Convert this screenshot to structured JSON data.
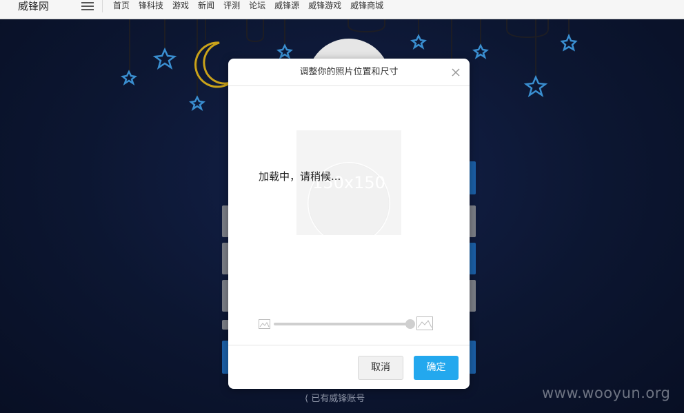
{
  "site": {
    "logo": "威锋网",
    "nav": [
      "首页",
      "锋科技",
      "游戏",
      "新闻",
      "评测",
      "论坛",
      "威锋源",
      "威锋游戏",
      "威锋商城"
    ]
  },
  "dialog": {
    "title": "调整你的照片位置和尺寸",
    "loading_text": "加载中，请稍候...",
    "placeholder_text": "150x150",
    "zoom_level": 1.0,
    "cancel_label": "取消",
    "confirm_label": "确定"
  },
  "page": {
    "login_link": "已有威锋账号",
    "watermark": "www.wooyun.org"
  },
  "colors": {
    "primary": "#23a8ee",
    "background": "#0c1530",
    "star": "#3a8fd1",
    "moon": "#c9a21a"
  },
  "icons": [
    "menu-icon",
    "close-icon",
    "image-small-icon",
    "image-large-icon",
    "chevron-left-icon",
    "star-icon",
    "moon-icon"
  ]
}
